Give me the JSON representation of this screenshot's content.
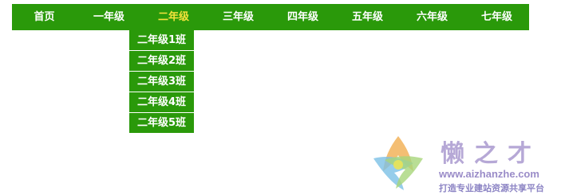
{
  "nav": {
    "items": [
      {
        "label": "首页"
      },
      {
        "label": "一年级"
      },
      {
        "label": "二年级"
      },
      {
        "label": "三年级"
      },
      {
        "label": "四年级"
      },
      {
        "label": "五年级"
      },
      {
        "label": "六年级"
      },
      {
        "label": "七年级"
      }
    ],
    "active_index": 2,
    "colors": {
      "background": "#2a990a",
      "text": "#ffffff",
      "active_text": "#f5e23b"
    }
  },
  "dropdown": {
    "items": [
      {
        "label": "二年级1班"
      },
      {
        "label": "二年级2班"
      },
      {
        "label": "二年级3班"
      },
      {
        "label": "二年级4班"
      },
      {
        "label": "二年级5班"
      }
    ]
  },
  "watermark": {
    "title": "懒之才",
    "url": "www.aizhanzhe.com",
    "tagline": "打造专业建站资源共享平台"
  }
}
